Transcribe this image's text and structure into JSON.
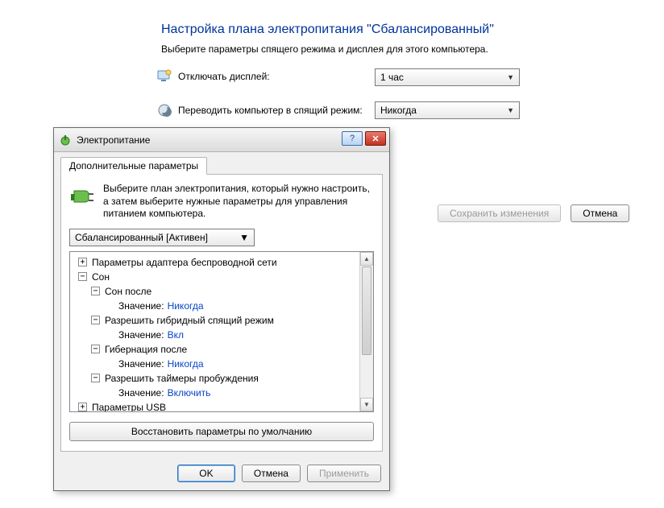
{
  "page": {
    "title": "Настройка плана электропитания \"Сбалансированный\"",
    "subtitle": "Выберите параметры спящего режима и дисплея для этого компьютера."
  },
  "settings": {
    "display_off": {
      "label": "Отключать дисплей:",
      "value": "1 час"
    },
    "sleep": {
      "label": "Переводить компьютер в спящий режим:",
      "value": "Никогда"
    }
  },
  "buttons": {
    "save": "Сохранить изменения",
    "cancel": "Отмена"
  },
  "dialog": {
    "title": "Электропитание",
    "tab": "Дополнительные параметры",
    "intro": "Выберите план электропитания, который нужно настроить, а затем выберите нужные параметры для управления питанием компьютера.",
    "plan_selected": "Сбалансированный [Активен]",
    "tree": {
      "wireless": "Параметры адаптера беспроводной сети",
      "sleep_group": "Сон",
      "sleep_after": "Сон после",
      "value_label": "Значение:",
      "sleep_after_value": "Никогда",
      "hybrid": "Разрешить гибридный спящий режим",
      "hybrid_value": "Вкл",
      "hibernate": "Гибернация после",
      "hibernate_value": "Никогда",
      "wake_timers": "Разрешить таймеры пробуждения",
      "wake_timers_value": "Включить",
      "usb": "Параметры USB"
    },
    "restore": "Восстановить параметры по умолчанию",
    "ok": "OK",
    "cancel": "Отмена",
    "apply": "Применить"
  }
}
